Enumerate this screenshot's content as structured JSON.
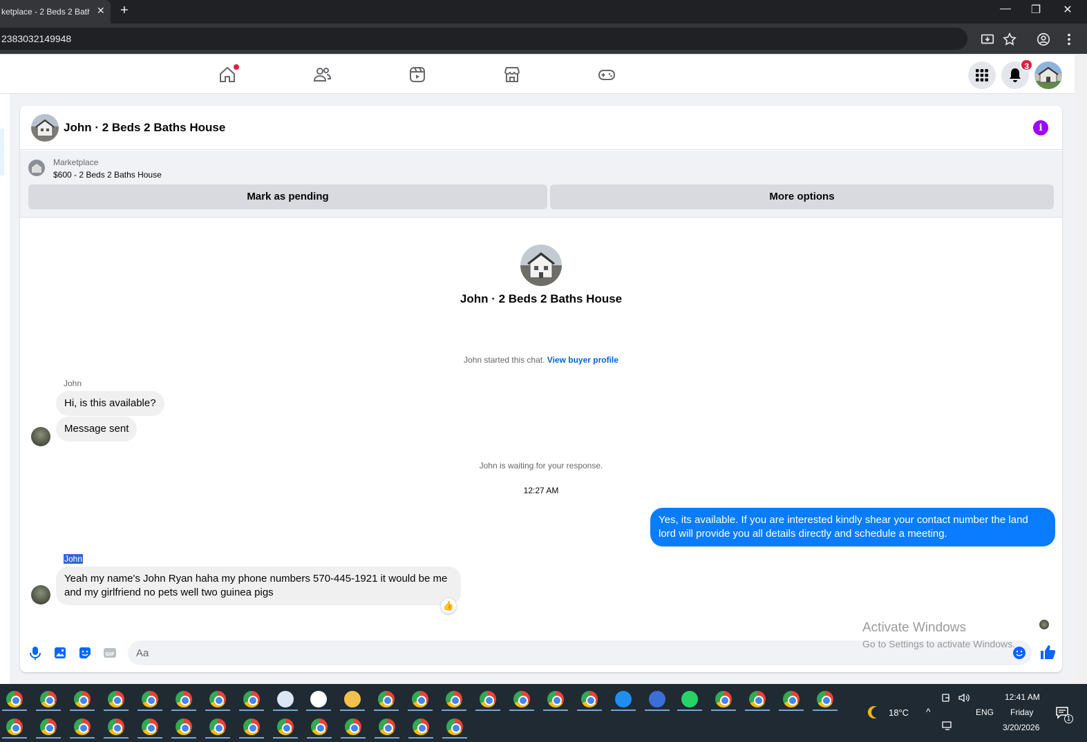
{
  "browser": {
    "tab_title": "ketplace - 2 Beds 2 Bath",
    "tab_close": "✕",
    "new_tab": "+",
    "url": "2383032149948",
    "window_controls": {
      "minimize": "—",
      "restore": "❐",
      "close": "✕"
    }
  },
  "fb_nav": {
    "notifications_count": "3"
  },
  "conversation": {
    "header_title": "John · 2 Beds 2 Baths House",
    "info_label": "i",
    "marketplace": {
      "label": "Marketplace",
      "item": "$600 - 2 Beds 2 Baths House",
      "mark_pending": "Mark as pending",
      "more_options": "More options"
    },
    "center_title": "John · 2 Beds 2 Baths House",
    "started_text": "John started this chat.",
    "view_profile": "View buyer profile",
    "messages": [
      {
        "sender": "John",
        "text": "Hi, is this available?"
      },
      {
        "text": "Message sent"
      }
    ],
    "waiting_text": "John is waiting for your response.",
    "timestamp": "12:27 AM",
    "outgoing": "Yes, its available. If you are interested kindly shear your contact number the land lord will provide you all details directly and schedule a meeting.",
    "second_sender": "John",
    "reply": "Yeah my name's John Ryan haha my phone numbers 570-445-1921 it would be me and my girlfriend no pets well two guinea pigs",
    "reaction": "👍",
    "composer_placeholder": "Aa"
  },
  "watermark": {
    "line1": "Activate Windows",
    "line2": "Go to Settings to activate Windows."
  },
  "taskbar": {
    "weather": "18°C",
    "language": "ENG",
    "time": "12:41 AM",
    "day": "Friday",
    "date": "3/20/2026",
    "notif_count": "1"
  },
  "colors": {
    "accent": "#0a7cff",
    "link": "#0064d1",
    "info": "#a100ff",
    "badge": "#e41e3f"
  }
}
